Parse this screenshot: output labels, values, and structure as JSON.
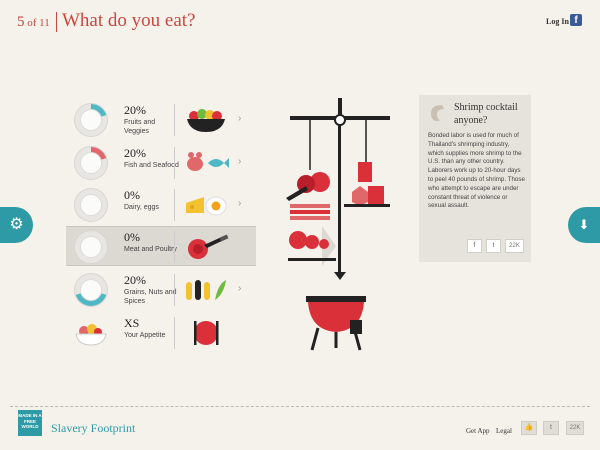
{
  "header": {
    "step_current": "5",
    "step_of": " of 11",
    "title": "What do you eat?",
    "login_label": "Log In",
    "facebook_label": "f"
  },
  "nav": {
    "settings_icon": "gear-icon",
    "next_icon": "arrow-down-icon"
  },
  "categories": [
    {
      "percent": "20%",
      "label": "Fruits and Veggies",
      "fill": 0.2,
      "fill_color": "#4fb8c4"
    },
    {
      "percent": "20%",
      "label": "Fish and Seafood",
      "fill": 0.2,
      "fill_color": "#e0676a"
    },
    {
      "percent": "0%",
      "label": "Dairy, eggs",
      "fill": 0,
      "fill_color": "#f2c230"
    },
    {
      "percent": "0%",
      "label": "Meat and Poultry",
      "fill": 0,
      "fill_color": "#d9303a",
      "active": true
    },
    {
      "percent": "20%",
      "label": "Grains, Nuts and Spices",
      "fill": 0.2,
      "fill_color": "#4fb8c4"
    },
    {
      "percent": "XS",
      "label": "Your Appetite",
      "fill": 0,
      "fill_color": "#e0676a"
    }
  ],
  "info": {
    "title": "Shrimp cocktail anyone?",
    "body": "Bonded labor is used for much of Thailand's shrimping industry, which supplies more shrimp to the U.S. than any other country. Laborers work up to 20-hour days to peel 40 pounds of shrimp. Those who attempt to escape are under constant threat of violence or sexual assault.",
    "share_facebook": "f",
    "share_twitter": "t",
    "share_count": "22K"
  },
  "footer": {
    "badge": "MADE IN A FREE WORLD",
    "brand": "Slavery Footprint",
    "get_app": "Get App",
    "legal": "Legal",
    "like_label": "👍",
    "twitter_label": "t",
    "count": "22K"
  },
  "colors": {
    "accent": "#c8473e",
    "teal": "#2e9aa6",
    "meat_red": "#d9303a"
  }
}
